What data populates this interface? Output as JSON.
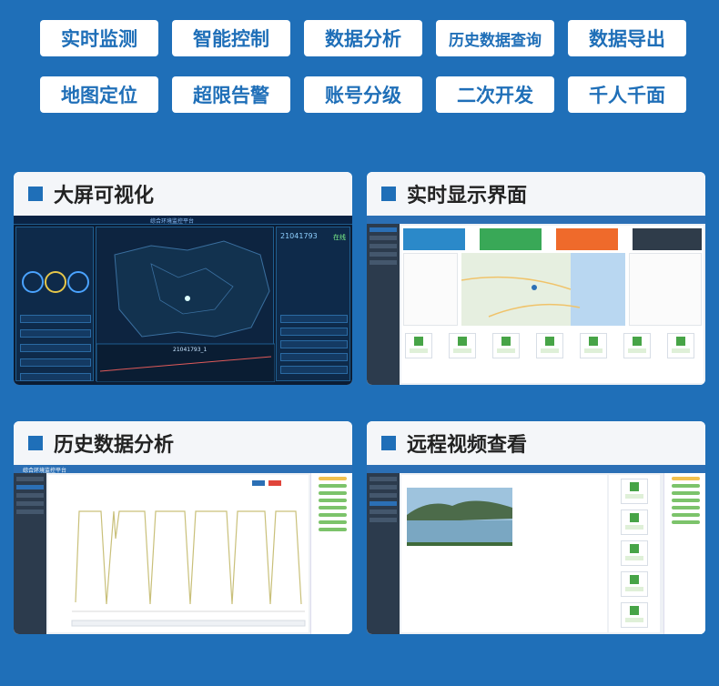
{
  "features": [
    "实时监测",
    "智能控制",
    "数据分析",
    "历史数据查询",
    "数据导出",
    "地图定位",
    "超限告警",
    "账号分级",
    "二次开发",
    "千人千面"
  ],
  "cards": [
    {
      "title": "大屏可视化",
      "shot": "dark-dashboard"
    },
    {
      "title": "实时显示界面",
      "shot": "map-dashboard"
    },
    {
      "title": "历史数据分析",
      "shot": "history-chart"
    },
    {
      "title": "远程视频查看",
      "shot": "video-view"
    }
  ],
  "dark_screen": {
    "platform_title": "综合环境监控平台",
    "device_id": "21041793",
    "status": "在线",
    "center_label": "21041793_1"
  },
  "history": {
    "platform_title": "综合环境监控平台"
  },
  "colors": {
    "background": "#1f6fb8",
    "accent": "#1f6fb8",
    "pill_bg": "#ffffff"
  }
}
